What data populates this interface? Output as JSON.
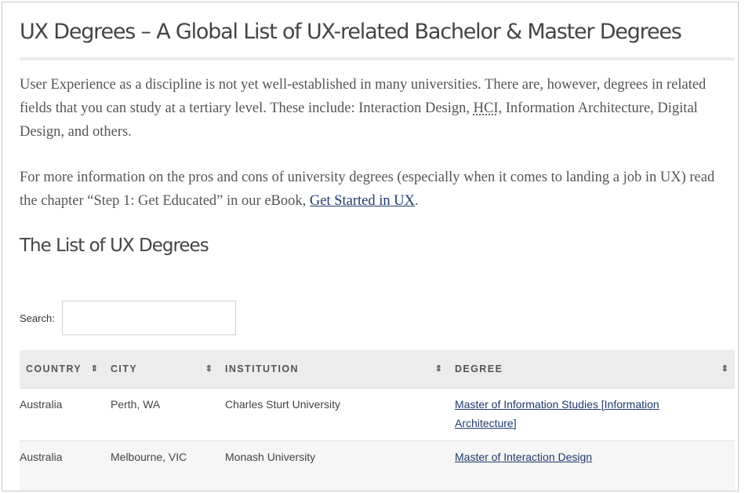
{
  "page": {
    "title": "UX Degrees – A Global List of UX-related Bachelor & Master Degrees",
    "intro_paragraph": {
      "before_abbr": "User Experience as a discipline is not yet well-established in many universities. There are, however, degrees in related fields that you can study at a tertiary level. These include: Interaction Design, ",
      "abbr": "HCI",
      "after_abbr": ", Information Architecture, Digital Design, and others."
    },
    "second_paragraph": {
      "text": "For more information on the pros and cons of university degrees (especially when it comes to landing a job in UX) read the chapter “Step 1: Get Educated” in our eBook, ",
      "link_text": "Get Started in UX",
      "after_link": "."
    },
    "section_heading": "The List of UX Degrees"
  },
  "search": {
    "label": "Search:",
    "value": ""
  },
  "table": {
    "headers": {
      "country": "COUNTRY",
      "city": "CITY",
      "institution": "INSTITUTION",
      "degree": "DEGREE"
    },
    "sort_icon": "sort-up-down-icon",
    "rows": [
      {
        "country": "Australia",
        "city": "Perth, WA",
        "institution": "Charles Sturt University",
        "degree": "Master of Information Studies [Information Architecture]"
      },
      {
        "country": "Australia",
        "city": "Melbourne, VIC",
        "institution": "Monash University",
        "degree": "Master of Interaction Design"
      }
    ]
  },
  "colors": {
    "link": "#1f3a6e",
    "header_bg": "#ececec",
    "text": "#555555"
  }
}
